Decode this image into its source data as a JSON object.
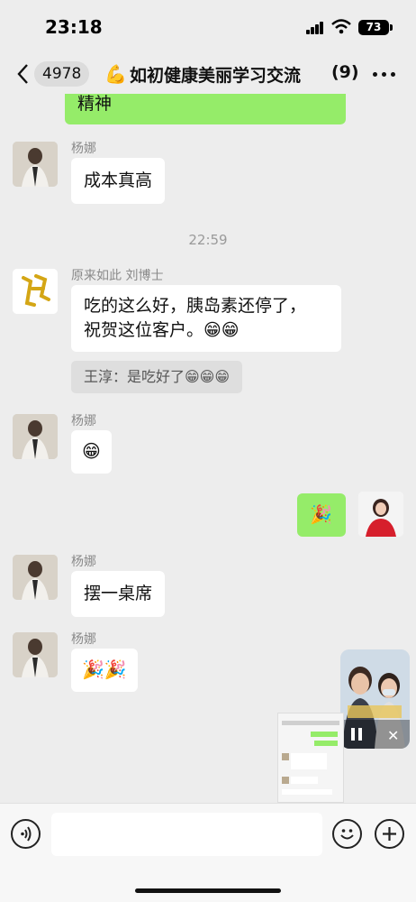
{
  "status_bar": {
    "time": "23:18",
    "battery": "73"
  },
  "header": {
    "unread_count": "4978",
    "title": "如初健康美丽学习交流",
    "member_count": "(9)"
  },
  "messages": {
    "partial_text": "精神",
    "m1": {
      "sender": "杨娜",
      "text": "成本真高"
    },
    "timestamp": "22:59",
    "m2": {
      "sender": "原来如此 刘博士",
      "line1": "吃的这么好，胰岛素还停了，",
      "line2": "祝贺这位客户。😁😁",
      "quote": "王淳：是吃好了😁😁😁"
    },
    "m3": {
      "sender": "杨娜",
      "text": "😁"
    },
    "m4": {
      "text": "🎉"
    },
    "m5": {
      "sender": "杨娜",
      "text": "摆一桌席"
    },
    "m6": {
      "sender": "杨娜",
      "text": "🎉🎉"
    }
  },
  "colors": {
    "background": "#ededed",
    "bubble_green": "#95ec69",
    "bubble_white": "#ffffff"
  }
}
